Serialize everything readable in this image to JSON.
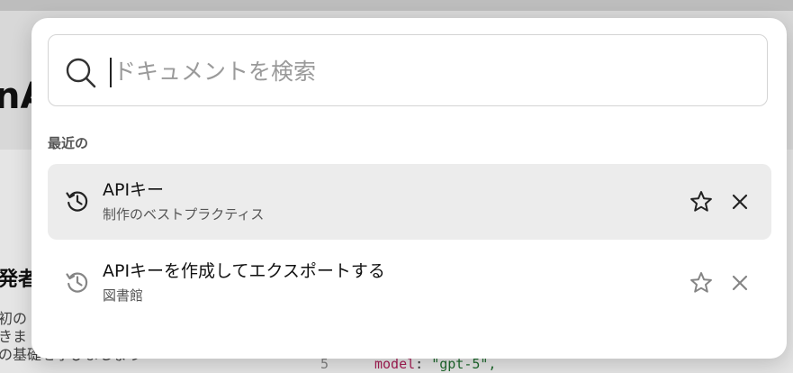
{
  "background": {
    "hero_title": "nA",
    "section_title": "発者",
    "body_lines": [
      "初の",
      "きま",
      "の基礎を学びましょう"
    ],
    "code": {
      "line_no": "5",
      "key": "model",
      "value": "\"gpt-5\","
    }
  },
  "search": {
    "placeholder": "ドキュメントを検索",
    "value": ""
  },
  "recent": {
    "label": "最近の",
    "items": [
      {
        "title": "APIキー",
        "subtitle": "制作のベストプラクティス"
      },
      {
        "title": "APIキーを作成してエクスポートする",
        "subtitle": "図書館"
      }
    ]
  },
  "icons": {
    "search": "search-icon",
    "history": "history-icon",
    "star": "star-outline-icon",
    "close": "close-icon"
  }
}
